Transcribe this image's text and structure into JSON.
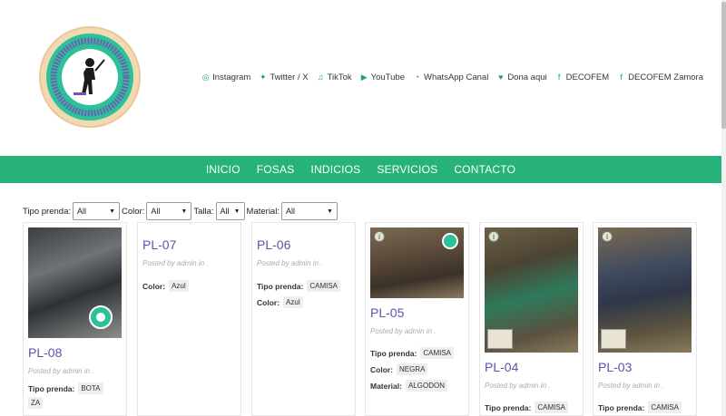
{
  "social": [
    {
      "icon": "instagram-icon",
      "glyph": "◎",
      "label": "Instagram"
    },
    {
      "icon": "twitter-icon",
      "glyph": "✦",
      "label": "Twitter / X"
    },
    {
      "icon": "tiktok-icon",
      "glyph": "♫",
      "label": "TikTok"
    },
    {
      "icon": "youtube-icon",
      "glyph": "▶",
      "label": "YouTube"
    },
    {
      "icon": "whatsapp-icon",
      "glyph": "◔",
      "label": "WhatsApp Canal"
    },
    {
      "icon": "donate-icon",
      "glyph": "♥",
      "label": "Dona aqui"
    },
    {
      "icon": "facebook-icon",
      "glyph": "f",
      "label": "DECOFEM"
    },
    {
      "icon": "facebook-icon",
      "glyph": "f",
      "label": "DECOFEM Zamora"
    }
  ],
  "nav": [
    "INICIO",
    "FOSAS",
    "INDICIOS",
    "SERVICIOS",
    "CONTACTO"
  ],
  "filters": {
    "tipo_prenda_label": "Tipo prenda:",
    "tipo_prenda_value": "All",
    "color_label": "Color:",
    "color_value": "All",
    "talla_label": "Talla:",
    "talla_value": "All",
    "material_label": "Material:",
    "material_value": "All"
  },
  "cards": [
    {
      "title": "PL-08",
      "meta": "Posted by admin in .",
      "attrs": [
        {
          "k": "Tipo prenda:",
          "v": "BOTA"
        }
      ],
      "extra": "ZA"
    },
    {
      "title": "PL-07",
      "meta": "Posted by admin in .",
      "attrs": [
        {
          "k": "Color:",
          "v": "Azul"
        }
      ]
    },
    {
      "title": "PL-06",
      "meta": "Posted by admin in .",
      "attrs": [
        {
          "k": "Tipo prenda:",
          "v": "CAMISA"
        },
        {
          "k": "Color:",
          "v": "Azul"
        }
      ]
    },
    {
      "title": "PL-05",
      "meta": "Posted by admin in .",
      "attrs": [
        {
          "k": "Tipo prenda:",
          "v": "CAMISA"
        },
        {
          "k": "Color:",
          "v": "NEGRA"
        },
        {
          "k": "Material:",
          "v": "ALGODON"
        }
      ]
    },
    {
      "title": "PL-04",
      "meta": "Posted by admin in .",
      "attrs": [
        {
          "k": "Tipo prenda:",
          "v": "CAMISA"
        }
      ]
    },
    {
      "title": "PL-03",
      "meta": "Posted by admin in .",
      "attrs": [
        {
          "k": "Tipo prenda:",
          "v": "CAMISA"
        }
      ]
    }
  ],
  "colors": {
    "accent": "#27b27a",
    "title": "#5a55a8"
  }
}
